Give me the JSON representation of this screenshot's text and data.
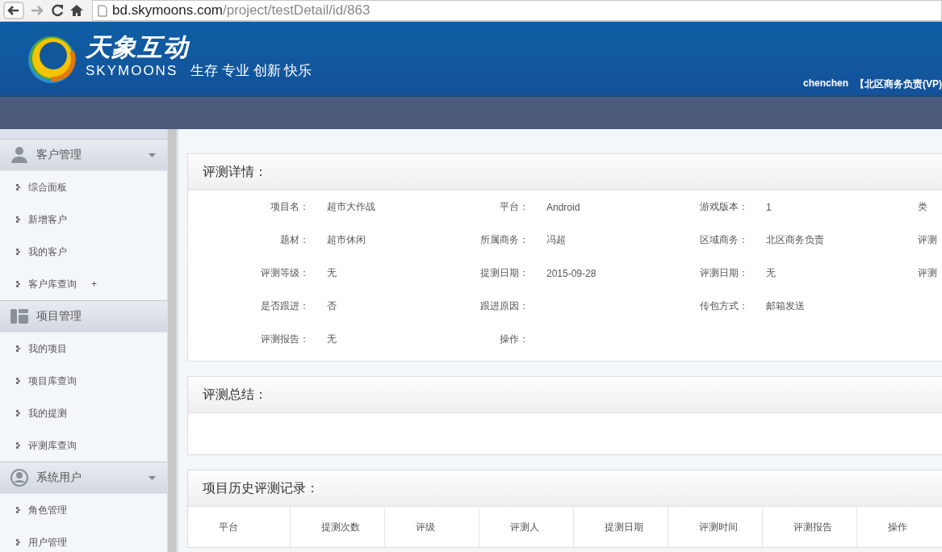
{
  "browser": {
    "url_host": "bd.skymoons.com",
    "url_path": "/project/testDetail/id/863"
  },
  "header": {
    "brand": "天象互动",
    "brand_latin": "SKYMOONS",
    "slogan": "生存 专业 创新 快乐",
    "user": "chenchen",
    "role": "【北区商务负责(VP)"
  },
  "sidebar": {
    "groups": [
      {
        "title": "客户管理",
        "kind": "person",
        "expanded": true,
        "items": [
          {
            "label": "综合面板"
          },
          {
            "label": "新增客户"
          },
          {
            "label": "我的客户"
          },
          {
            "label": "客户库查询",
            "badge": "+"
          }
        ]
      },
      {
        "title": "项目管理",
        "kind": "layout",
        "items": [
          {
            "label": "我的项目"
          },
          {
            "label": "项目库查询"
          },
          {
            "label": "我的提测"
          },
          {
            "label": "评测库查询"
          }
        ]
      },
      {
        "title": "系统用户",
        "kind": "user-circle",
        "expanded": true,
        "items": [
          {
            "label": "角色管理"
          },
          {
            "label": "用户管理"
          }
        ]
      }
    ]
  },
  "detail": {
    "title": "评测详情：",
    "rows": [
      [
        {
          "label": "项目名：",
          "value": "超市大作战"
        },
        {
          "label": "平台：",
          "value": "Android"
        },
        {
          "label": "游戏版本：",
          "value": "1"
        },
        {
          "label": "类"
        }
      ],
      [
        {
          "label": "题材：",
          "value": "超市休闲"
        },
        {
          "label": "所属商务：",
          "value": "冯超"
        },
        {
          "label": "区域商务：",
          "value": "北区商务负责"
        },
        {
          "label": "评测"
        }
      ],
      [
        {
          "label": "评测等级：",
          "value": "无"
        },
        {
          "label": "提测日期：",
          "value": "2015-09-28"
        },
        {
          "label": "评测日期：",
          "value": "无"
        },
        {
          "label": "评测"
        }
      ],
      [
        {
          "label": "是否跟进：",
          "value": "否"
        },
        {
          "label": "跟进原因："
        },
        {
          "label": "传包方式：",
          "value": "邮箱发送"
        }
      ],
      [
        {
          "label": "评测报告：",
          "value": "无"
        },
        {
          "label": "操作："
        }
      ]
    ]
  },
  "summary": {
    "title": "评测总结："
  },
  "history": {
    "title": "项目历史评测记录：",
    "columns": [
      "平台",
      "提测次数",
      "评级",
      "评测人",
      "提测日期",
      "评测时间",
      "评测报告",
      "操作"
    ]
  }
}
